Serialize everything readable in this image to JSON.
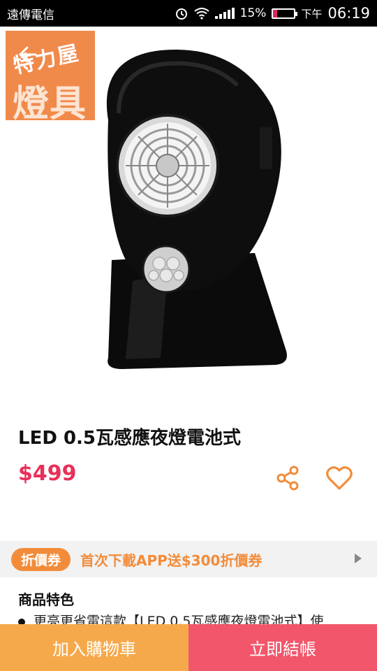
{
  "status_bar": {
    "carrier": "遠傳電信",
    "battery": "15%",
    "ampm": "下午",
    "time": "06:19"
  },
  "brand_logo": {
    "line1": "特力屋",
    "line2": "燈具"
  },
  "product": {
    "title": "LED 0.5瓦感應夜燈電池式",
    "price": "$499"
  },
  "coupon": {
    "badge": "折價券",
    "text": "首次下載APP送$300折價券"
  },
  "features": {
    "title": "商品特色",
    "item": "更亮更省電這款【LED 0.5瓦感應夜燈電池式】使"
  },
  "bottom_bar": {
    "add_to_cart": "加入購物車",
    "checkout": "立即結帳"
  },
  "colors": {
    "price": "#e8305a",
    "accent": "#f28c3a",
    "cart_button": "#f6a94b",
    "checkout_button": "#f2566b"
  },
  "icons": [
    "back-arrow-icon",
    "search-icon",
    "cart-icon",
    "share-icon",
    "heart-icon",
    "chevron-right-icon"
  ]
}
